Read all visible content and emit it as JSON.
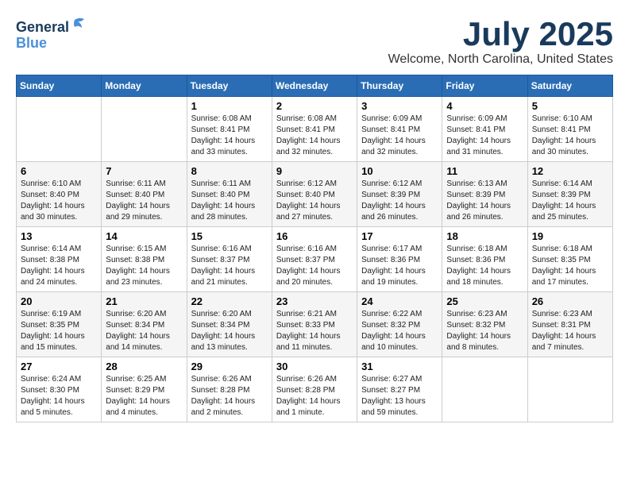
{
  "header": {
    "logo_line1": "General",
    "logo_line2": "Blue",
    "month_year": "July 2025",
    "location": "Welcome, North Carolina, United States"
  },
  "weekdays": [
    "Sunday",
    "Monday",
    "Tuesday",
    "Wednesday",
    "Thursday",
    "Friday",
    "Saturday"
  ],
  "weeks": [
    [
      {
        "day": "",
        "info": ""
      },
      {
        "day": "",
        "info": ""
      },
      {
        "day": "1",
        "info": "Sunrise: 6:08 AM\nSunset: 8:41 PM\nDaylight: 14 hours and 33 minutes."
      },
      {
        "day": "2",
        "info": "Sunrise: 6:08 AM\nSunset: 8:41 PM\nDaylight: 14 hours and 32 minutes."
      },
      {
        "day": "3",
        "info": "Sunrise: 6:09 AM\nSunset: 8:41 PM\nDaylight: 14 hours and 32 minutes."
      },
      {
        "day": "4",
        "info": "Sunrise: 6:09 AM\nSunset: 8:41 PM\nDaylight: 14 hours and 31 minutes."
      },
      {
        "day": "5",
        "info": "Sunrise: 6:10 AM\nSunset: 8:41 PM\nDaylight: 14 hours and 30 minutes."
      }
    ],
    [
      {
        "day": "6",
        "info": "Sunrise: 6:10 AM\nSunset: 8:40 PM\nDaylight: 14 hours and 30 minutes."
      },
      {
        "day": "7",
        "info": "Sunrise: 6:11 AM\nSunset: 8:40 PM\nDaylight: 14 hours and 29 minutes."
      },
      {
        "day": "8",
        "info": "Sunrise: 6:11 AM\nSunset: 8:40 PM\nDaylight: 14 hours and 28 minutes."
      },
      {
        "day": "9",
        "info": "Sunrise: 6:12 AM\nSunset: 8:40 PM\nDaylight: 14 hours and 27 minutes."
      },
      {
        "day": "10",
        "info": "Sunrise: 6:12 AM\nSunset: 8:39 PM\nDaylight: 14 hours and 26 minutes."
      },
      {
        "day": "11",
        "info": "Sunrise: 6:13 AM\nSunset: 8:39 PM\nDaylight: 14 hours and 26 minutes."
      },
      {
        "day": "12",
        "info": "Sunrise: 6:14 AM\nSunset: 8:39 PM\nDaylight: 14 hours and 25 minutes."
      }
    ],
    [
      {
        "day": "13",
        "info": "Sunrise: 6:14 AM\nSunset: 8:38 PM\nDaylight: 14 hours and 24 minutes."
      },
      {
        "day": "14",
        "info": "Sunrise: 6:15 AM\nSunset: 8:38 PM\nDaylight: 14 hours and 23 minutes."
      },
      {
        "day": "15",
        "info": "Sunrise: 6:16 AM\nSunset: 8:37 PM\nDaylight: 14 hours and 21 minutes."
      },
      {
        "day": "16",
        "info": "Sunrise: 6:16 AM\nSunset: 8:37 PM\nDaylight: 14 hours and 20 minutes."
      },
      {
        "day": "17",
        "info": "Sunrise: 6:17 AM\nSunset: 8:36 PM\nDaylight: 14 hours and 19 minutes."
      },
      {
        "day": "18",
        "info": "Sunrise: 6:18 AM\nSunset: 8:36 PM\nDaylight: 14 hours and 18 minutes."
      },
      {
        "day": "19",
        "info": "Sunrise: 6:18 AM\nSunset: 8:35 PM\nDaylight: 14 hours and 17 minutes."
      }
    ],
    [
      {
        "day": "20",
        "info": "Sunrise: 6:19 AM\nSunset: 8:35 PM\nDaylight: 14 hours and 15 minutes."
      },
      {
        "day": "21",
        "info": "Sunrise: 6:20 AM\nSunset: 8:34 PM\nDaylight: 14 hours and 14 minutes."
      },
      {
        "day": "22",
        "info": "Sunrise: 6:20 AM\nSunset: 8:34 PM\nDaylight: 14 hours and 13 minutes."
      },
      {
        "day": "23",
        "info": "Sunrise: 6:21 AM\nSunset: 8:33 PM\nDaylight: 14 hours and 11 minutes."
      },
      {
        "day": "24",
        "info": "Sunrise: 6:22 AM\nSunset: 8:32 PM\nDaylight: 14 hours and 10 minutes."
      },
      {
        "day": "25",
        "info": "Sunrise: 6:23 AM\nSunset: 8:32 PM\nDaylight: 14 hours and 8 minutes."
      },
      {
        "day": "26",
        "info": "Sunrise: 6:23 AM\nSunset: 8:31 PM\nDaylight: 14 hours and 7 minutes."
      }
    ],
    [
      {
        "day": "27",
        "info": "Sunrise: 6:24 AM\nSunset: 8:30 PM\nDaylight: 14 hours and 5 minutes."
      },
      {
        "day": "28",
        "info": "Sunrise: 6:25 AM\nSunset: 8:29 PM\nDaylight: 14 hours and 4 minutes."
      },
      {
        "day": "29",
        "info": "Sunrise: 6:26 AM\nSunset: 8:28 PM\nDaylight: 14 hours and 2 minutes."
      },
      {
        "day": "30",
        "info": "Sunrise: 6:26 AM\nSunset: 8:28 PM\nDaylight: 14 hours and 1 minute."
      },
      {
        "day": "31",
        "info": "Sunrise: 6:27 AM\nSunset: 8:27 PM\nDaylight: 13 hours and 59 minutes."
      },
      {
        "day": "",
        "info": ""
      },
      {
        "day": "",
        "info": ""
      }
    ]
  ]
}
